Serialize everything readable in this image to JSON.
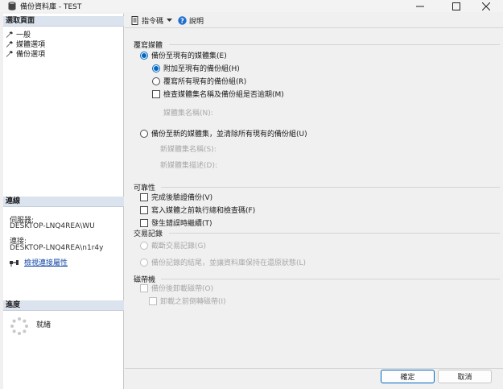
{
  "window": {
    "title": "備份資料庫 - TEST",
    "icon": "database-icon"
  },
  "left": {
    "select_page": {
      "header": "選取頁面",
      "items": [
        {
          "label": "一般",
          "icon": "wrench-icon"
        },
        {
          "label": "媒體選項",
          "icon": "wrench-icon"
        },
        {
          "label": "備份選項",
          "icon": "wrench-icon"
        }
      ]
    },
    "connection": {
      "header": "連線",
      "server_label": "伺服器:",
      "server_value": "DESKTOP-LNQ4REA\\WU",
      "conn_label": "連接:",
      "conn_value": "DESKTOP-LNQ4REA\\n1r4y",
      "view_props": "檢視連接屬性"
    },
    "progress": {
      "header": "進度",
      "status": "就緒"
    }
  },
  "toolbar": {
    "script_label": "指令碼",
    "help_label": "說明"
  },
  "overwrite": {
    "header": "覆寫媒體",
    "existing": "備份至現有的媒體集(E)",
    "append": "附加至現有的備份組(H)",
    "overwrite_all": "覆寫所有現有的備份組(R)",
    "check_name": "檢查媒體集名稱及備份組是否逾期(M)",
    "media_name_label": "媒體集名稱(N):",
    "new_media": "備份至新的媒體集，並清除所有現有的備份組(U)",
    "new_media_name_label": "新媒體集名稱(S):",
    "new_media_desc_label": "新媒體集描述(D):"
  },
  "reliability": {
    "header": "可靠性",
    "verify": "完成後驗證備份(V)",
    "checksum": "寫入媒體之前執行總和檢查碼(F)",
    "continue_on_error": "發生錯誤時繼續(T)"
  },
  "tlog": {
    "header": "交易記錄",
    "truncate": "截斷交易記錄(G)",
    "tail": "備份記錄的結尾，並讓資料庫保持在還原狀態(L)"
  },
  "tape": {
    "header": "磁帶機",
    "unload": "備份後卸載磁帶(O)",
    "rewind": "卸載之前倒轉磁帶(I)"
  },
  "buttons": {
    "ok": "確定",
    "cancel": "取消"
  },
  "colors": {
    "accent": "#0067c0",
    "link": "#1a4ba8",
    "section_header": "#dbe3ee"
  }
}
